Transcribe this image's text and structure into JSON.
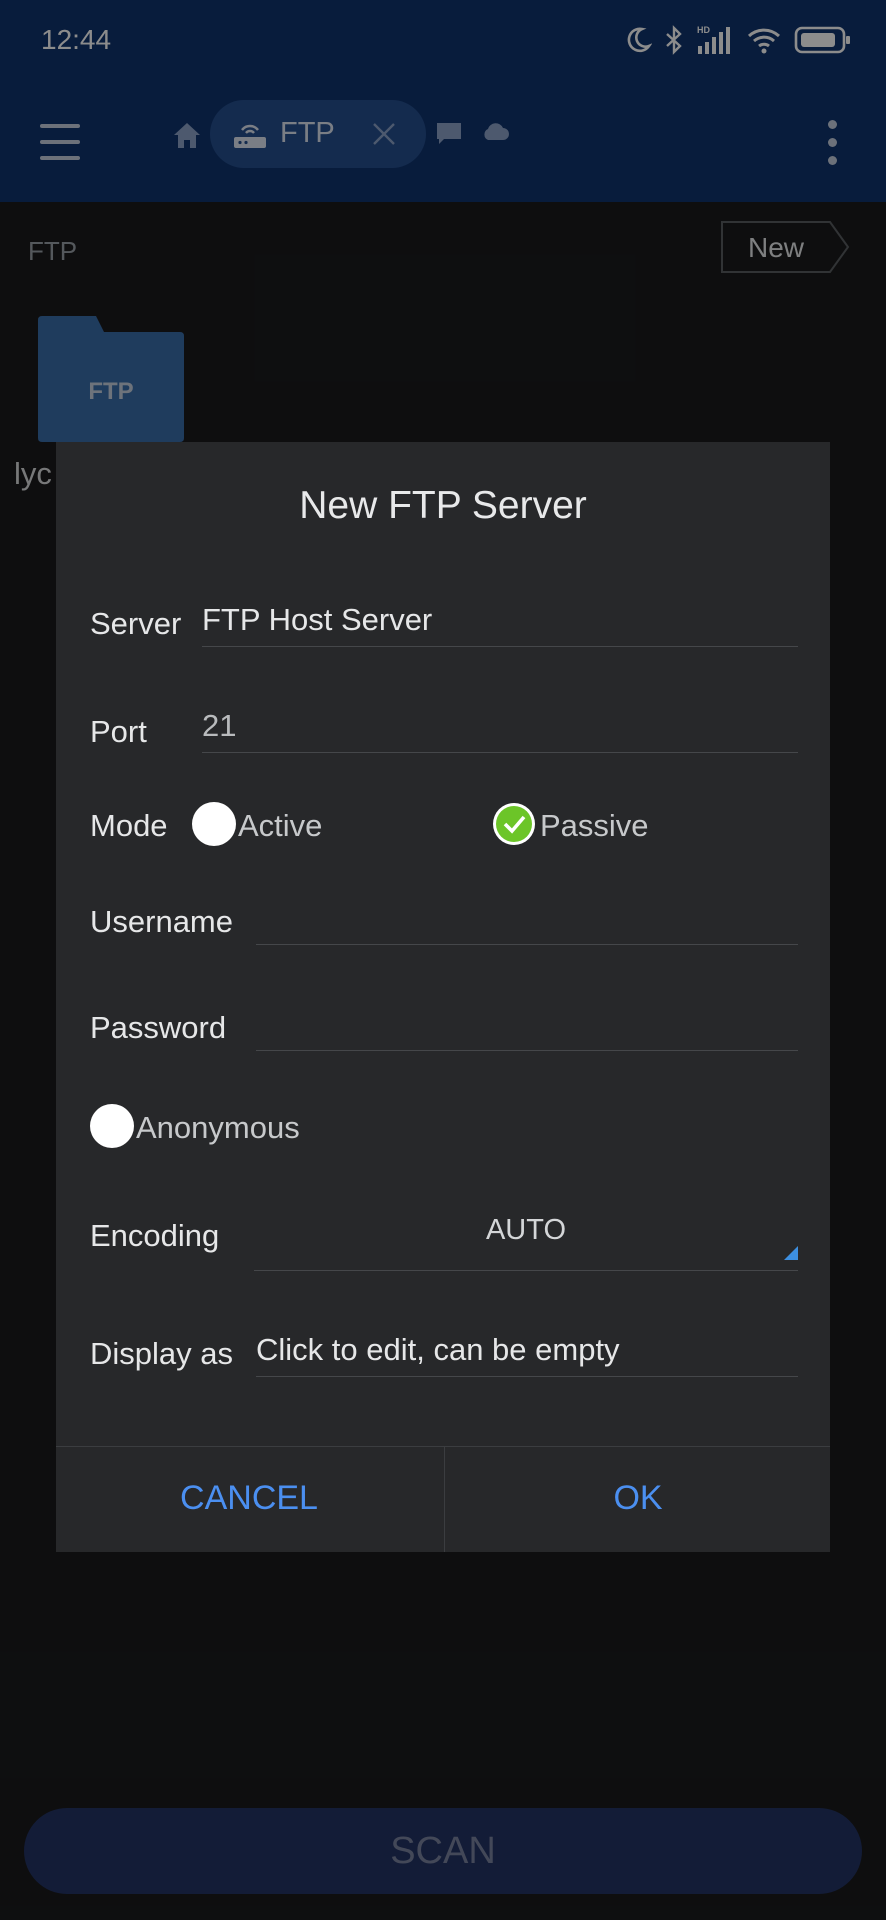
{
  "status_bar": {
    "time": "12:44",
    "icons": [
      "moon-icon",
      "bluetooth-icon",
      "hd-signal-icon",
      "wifi-icon",
      "battery-icon"
    ]
  },
  "toolbar": {
    "menu_icon": "hamburger-menu-icon",
    "home_icon": "home-icon",
    "active_tab": {
      "icon": "ftp-router-icon",
      "label": "FTP",
      "close_icon": "close-icon"
    },
    "extra_tabs": [
      "message-icon",
      "cloud-icon"
    ],
    "overflow_icon": "more-vertical-icon"
  },
  "content": {
    "path": "FTP",
    "new_button": "New",
    "folder": {
      "icon_label": "FTP",
      "name": "lyc"
    }
  },
  "dialog": {
    "title": "New FTP Server",
    "server": {
      "label": "Server",
      "value": "FTP Host Server"
    },
    "port": {
      "label": "Port",
      "value": "21"
    },
    "mode": {
      "label": "Mode",
      "options": [
        {
          "label": "Active",
          "selected": false
        },
        {
          "label": "Passive",
          "selected": true
        }
      ]
    },
    "username": {
      "label": "Username",
      "value": ""
    },
    "password": {
      "label": "Password",
      "value": ""
    },
    "anonymous": {
      "label": "Anonymous",
      "checked": false
    },
    "encoding": {
      "label": "Encoding",
      "value": "AUTO"
    },
    "display_as": {
      "label": "Display as",
      "placeholder": "Click to edit, can be empty"
    },
    "cancel": "CANCEL",
    "ok": "OK"
  },
  "scan_button": "SCAN",
  "colors": {
    "appbar": "#10346e",
    "tab": "#264f8f",
    "dialog_bg": "#27282a",
    "accent_button_text": "#4b8ff0",
    "check_green": "#6cc528",
    "scan_button": "#243465"
  }
}
